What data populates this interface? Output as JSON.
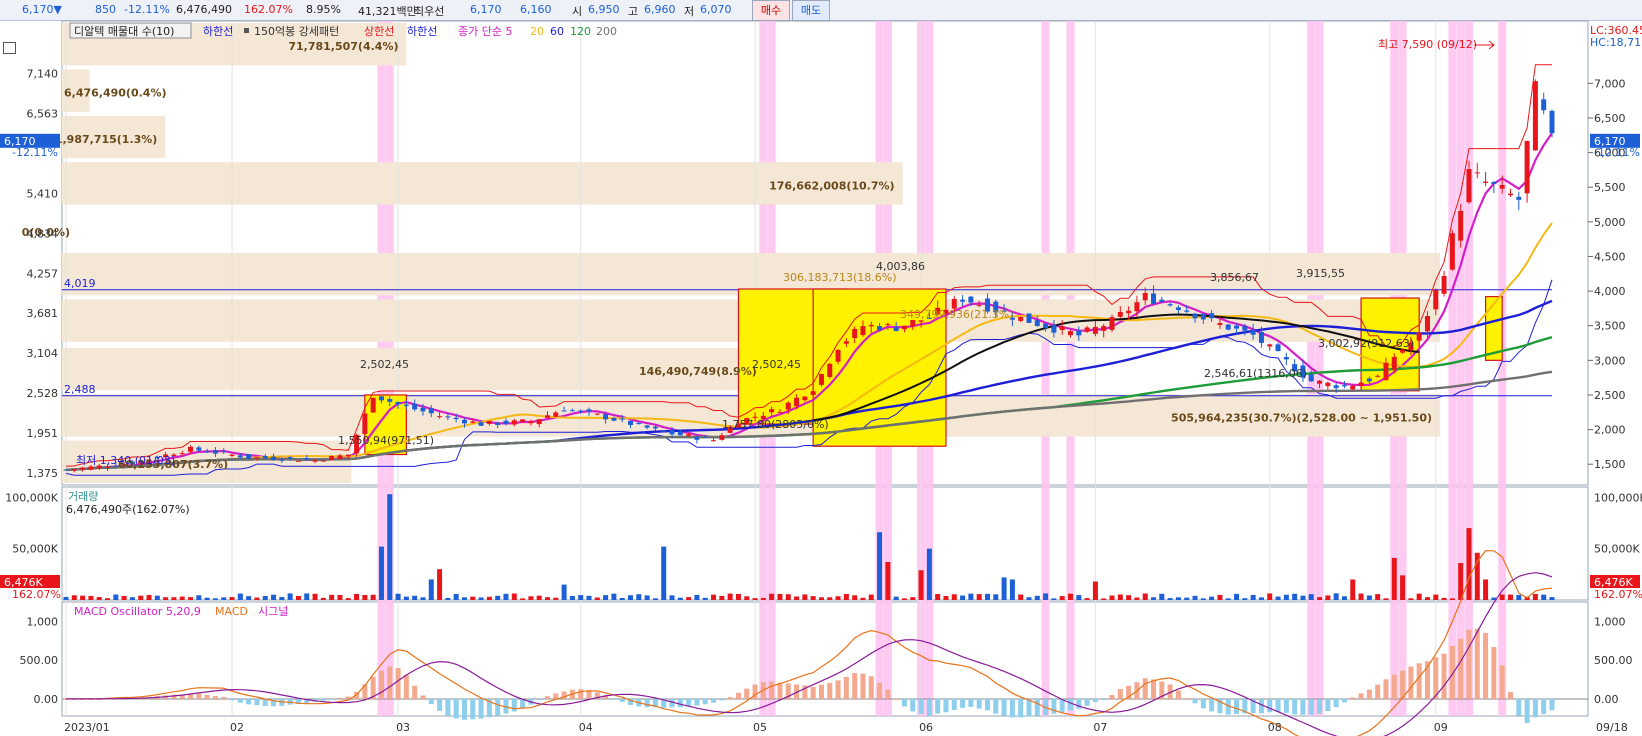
{
  "topbar": {
    "price": "6,170▼",
    "change": "850",
    "change_pct": "-12.11%",
    "volume": "6,476,490",
    "volume_ratio": "162.07%",
    "turnover": "8.95%",
    "amount": "41,321백만",
    "best_ask_label": "최우선",
    "best_ask": "6,170",
    "best_bid": "6,160",
    "open_label": "시",
    "open": "6,950",
    "high_label": "고",
    "high": "6,960",
    "low_label": "저",
    "low": "6,070",
    "buy_label": "매수",
    "sell_label": "매도"
  },
  "legend": {
    "title": "디알텍 매물대 수(10)",
    "lower_limit": "하한선",
    "pattern": "150억봉 강세패턴",
    "upper_line": "상한선",
    "lower_line": "하한선",
    "ma_label": "종가 단순 5",
    "ma20": "20",
    "ma60": "60",
    "ma120": "120",
    "ma200": "200"
  },
  "colors": {
    "up": "#e8161b",
    "down": "#1c5fd6",
    "ma5": "#d31ec9",
    "ma20": "#f5b914",
    "ma60": "#1d1fd8",
    "ma120": "#1e9c38",
    "ma200": "#707070",
    "highlight": "#ffc4f0",
    "box": "#fff200",
    "volume_profile": "#f4e7d6"
  },
  "chart_data": [
    {
      "type": "candlestick",
      "title": "디알텍",
      "ylim": [
        1200,
        7900
      ],
      "y_ticks": [
        "7,140",
        "6,563",
        "5,410",
        "4,834",
        "4,257",
        "3,681",
        "3,104",
        "2,528",
        "1,951",
        "1,375"
      ],
      "right_ticks": [
        "7,000",
        "6,500",
        "6,000",
        "5,500",
        "5,000",
        "4,500",
        "4,000",
        "3,500",
        "3,000",
        "2,500",
        "2,000",
        "1,500"
      ],
      "x_labels": [
        "2023/01",
        "02",
        "03",
        "04",
        "05",
        "06",
        "07",
        "08",
        "09",
        "09/18"
      ],
      "current_price": "6,170",
      "current_change": "-12.11%",
      "lc_label": "LC:360.45",
      "hc_label": "HC:18,71",
      "high_annotation": "최고 7,590 (09/12)",
      "low_annotation": "최저 1,340 (01/03)",
      "hlines": [
        {
          "value": 4019,
          "label": "4,019"
        },
        {
          "value": 2488,
          "label": "2,488"
        }
      ],
      "volume_profile": [
        {
          "label": "71,781,507(4.4%)",
          "share": 0.25
        },
        {
          "label": "6,476,490(0.4%)",
          "share": 0.02
        },
        {
          "label": "21,987,715(1.3%)",
          "share": 0.075
        },
        {
          "label": "176,662,008(10.7%)",
          "share": 0.61
        },
        {
          "label": "0(0.0%)",
          "share": 0.0
        },
        {
          "label": "",
          "share": 1.0
        },
        {
          "label": "",
          "share": 1.0
        },
        {
          "label": "146,490,749(8.9%)",
          "share": 0.51
        },
        {
          "label": "505,964,235(30.7%)(2,528.00 ~ 1,951.50)",
          "share": 1.0
        },
        {
          "label": "60,253,807(3.7%)",
          "share": 0.21
        }
      ],
      "box_annotations": [
        "2,502,45",
        "2,502,45",
        "4,003,86",
        "306,183,713(18.6%)",
        "349,799,936(21.3%)",
        "1,550,94(971,51)",
        "1,757,80(2805/0%)",
        "3,856,67",
        "3,915,55",
        "2,546,61(1316,06)",
        "3,002,92(912,63)"
      ],
      "series_names": [
        "종가 단순 5",
        "20",
        "60",
        "120",
        "200"
      ]
    },
    {
      "type": "bar",
      "title": "거래량",
      "subtitle": "6,476,490주(162.07%)",
      "y_ticks": [
        "100,000K",
        "50,000K"
      ],
      "current": "6,476K",
      "current_pct": "162.07%",
      "ylim": [
        0,
        110000
      ]
    },
    {
      "type": "bar",
      "title": "MACD Oscillator 5,20,9",
      "series_names": [
        "MACD",
        "시그널"
      ],
      "y_ticks": [
        "1,000",
        "500.00",
        "0.00"
      ],
      "ylim": [
        -220,
        1250
      ]
    }
  ]
}
